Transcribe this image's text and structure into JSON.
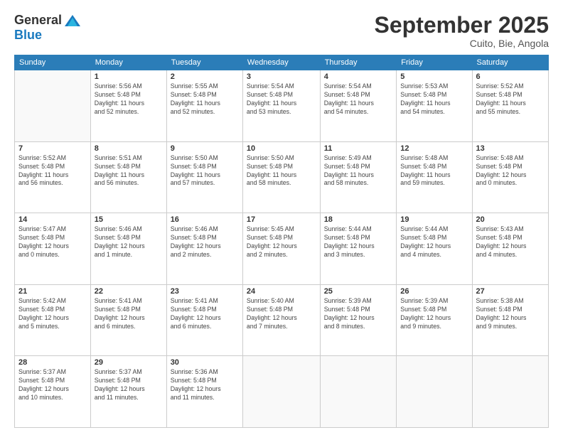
{
  "logo": {
    "general": "General",
    "blue": "Blue"
  },
  "header": {
    "month": "September 2025",
    "location": "Cuito, Bie, Angola"
  },
  "weekdays": [
    "Sunday",
    "Monday",
    "Tuesday",
    "Wednesday",
    "Thursday",
    "Friday",
    "Saturday"
  ],
  "weeks": [
    [
      {
        "date": "",
        "info": ""
      },
      {
        "date": "1",
        "info": "Sunrise: 5:56 AM\nSunset: 5:48 PM\nDaylight: 11 hours\nand 52 minutes."
      },
      {
        "date": "2",
        "info": "Sunrise: 5:55 AM\nSunset: 5:48 PM\nDaylight: 11 hours\nand 52 minutes."
      },
      {
        "date": "3",
        "info": "Sunrise: 5:54 AM\nSunset: 5:48 PM\nDaylight: 11 hours\nand 53 minutes."
      },
      {
        "date": "4",
        "info": "Sunrise: 5:54 AM\nSunset: 5:48 PM\nDaylight: 11 hours\nand 54 minutes."
      },
      {
        "date": "5",
        "info": "Sunrise: 5:53 AM\nSunset: 5:48 PM\nDaylight: 11 hours\nand 54 minutes."
      },
      {
        "date": "6",
        "info": "Sunrise: 5:52 AM\nSunset: 5:48 PM\nDaylight: 11 hours\nand 55 minutes."
      }
    ],
    [
      {
        "date": "7",
        "info": "Sunrise: 5:52 AM\nSunset: 5:48 PM\nDaylight: 11 hours\nand 56 minutes."
      },
      {
        "date": "8",
        "info": "Sunrise: 5:51 AM\nSunset: 5:48 PM\nDaylight: 11 hours\nand 56 minutes."
      },
      {
        "date": "9",
        "info": "Sunrise: 5:50 AM\nSunset: 5:48 PM\nDaylight: 11 hours\nand 57 minutes."
      },
      {
        "date": "10",
        "info": "Sunrise: 5:50 AM\nSunset: 5:48 PM\nDaylight: 11 hours\nand 58 minutes."
      },
      {
        "date": "11",
        "info": "Sunrise: 5:49 AM\nSunset: 5:48 PM\nDaylight: 11 hours\nand 58 minutes."
      },
      {
        "date": "12",
        "info": "Sunrise: 5:48 AM\nSunset: 5:48 PM\nDaylight: 11 hours\nand 59 minutes."
      },
      {
        "date": "13",
        "info": "Sunrise: 5:48 AM\nSunset: 5:48 PM\nDaylight: 12 hours\nand 0 minutes."
      }
    ],
    [
      {
        "date": "14",
        "info": "Sunrise: 5:47 AM\nSunset: 5:48 PM\nDaylight: 12 hours\nand 0 minutes."
      },
      {
        "date": "15",
        "info": "Sunrise: 5:46 AM\nSunset: 5:48 PM\nDaylight: 12 hours\nand 1 minute."
      },
      {
        "date": "16",
        "info": "Sunrise: 5:46 AM\nSunset: 5:48 PM\nDaylight: 12 hours\nand 2 minutes."
      },
      {
        "date": "17",
        "info": "Sunrise: 5:45 AM\nSunset: 5:48 PM\nDaylight: 12 hours\nand 2 minutes."
      },
      {
        "date": "18",
        "info": "Sunrise: 5:44 AM\nSunset: 5:48 PM\nDaylight: 12 hours\nand 3 minutes."
      },
      {
        "date": "19",
        "info": "Sunrise: 5:44 AM\nSunset: 5:48 PM\nDaylight: 12 hours\nand 4 minutes."
      },
      {
        "date": "20",
        "info": "Sunrise: 5:43 AM\nSunset: 5:48 PM\nDaylight: 12 hours\nand 4 minutes."
      }
    ],
    [
      {
        "date": "21",
        "info": "Sunrise: 5:42 AM\nSunset: 5:48 PM\nDaylight: 12 hours\nand 5 minutes."
      },
      {
        "date": "22",
        "info": "Sunrise: 5:41 AM\nSunset: 5:48 PM\nDaylight: 12 hours\nand 6 minutes."
      },
      {
        "date": "23",
        "info": "Sunrise: 5:41 AM\nSunset: 5:48 PM\nDaylight: 12 hours\nand 6 minutes."
      },
      {
        "date": "24",
        "info": "Sunrise: 5:40 AM\nSunset: 5:48 PM\nDaylight: 12 hours\nand 7 minutes."
      },
      {
        "date": "25",
        "info": "Sunrise: 5:39 AM\nSunset: 5:48 PM\nDaylight: 12 hours\nand 8 minutes."
      },
      {
        "date": "26",
        "info": "Sunrise: 5:39 AM\nSunset: 5:48 PM\nDaylight: 12 hours\nand 9 minutes."
      },
      {
        "date": "27",
        "info": "Sunrise: 5:38 AM\nSunset: 5:48 PM\nDaylight: 12 hours\nand 9 minutes."
      }
    ],
    [
      {
        "date": "28",
        "info": "Sunrise: 5:37 AM\nSunset: 5:48 PM\nDaylight: 12 hours\nand 10 minutes."
      },
      {
        "date": "29",
        "info": "Sunrise: 5:37 AM\nSunset: 5:48 PM\nDaylight: 12 hours\nand 11 minutes."
      },
      {
        "date": "30",
        "info": "Sunrise: 5:36 AM\nSunset: 5:48 PM\nDaylight: 12 hours\nand 11 minutes."
      },
      {
        "date": "",
        "info": ""
      },
      {
        "date": "",
        "info": ""
      },
      {
        "date": "",
        "info": ""
      },
      {
        "date": "",
        "info": ""
      }
    ]
  ]
}
